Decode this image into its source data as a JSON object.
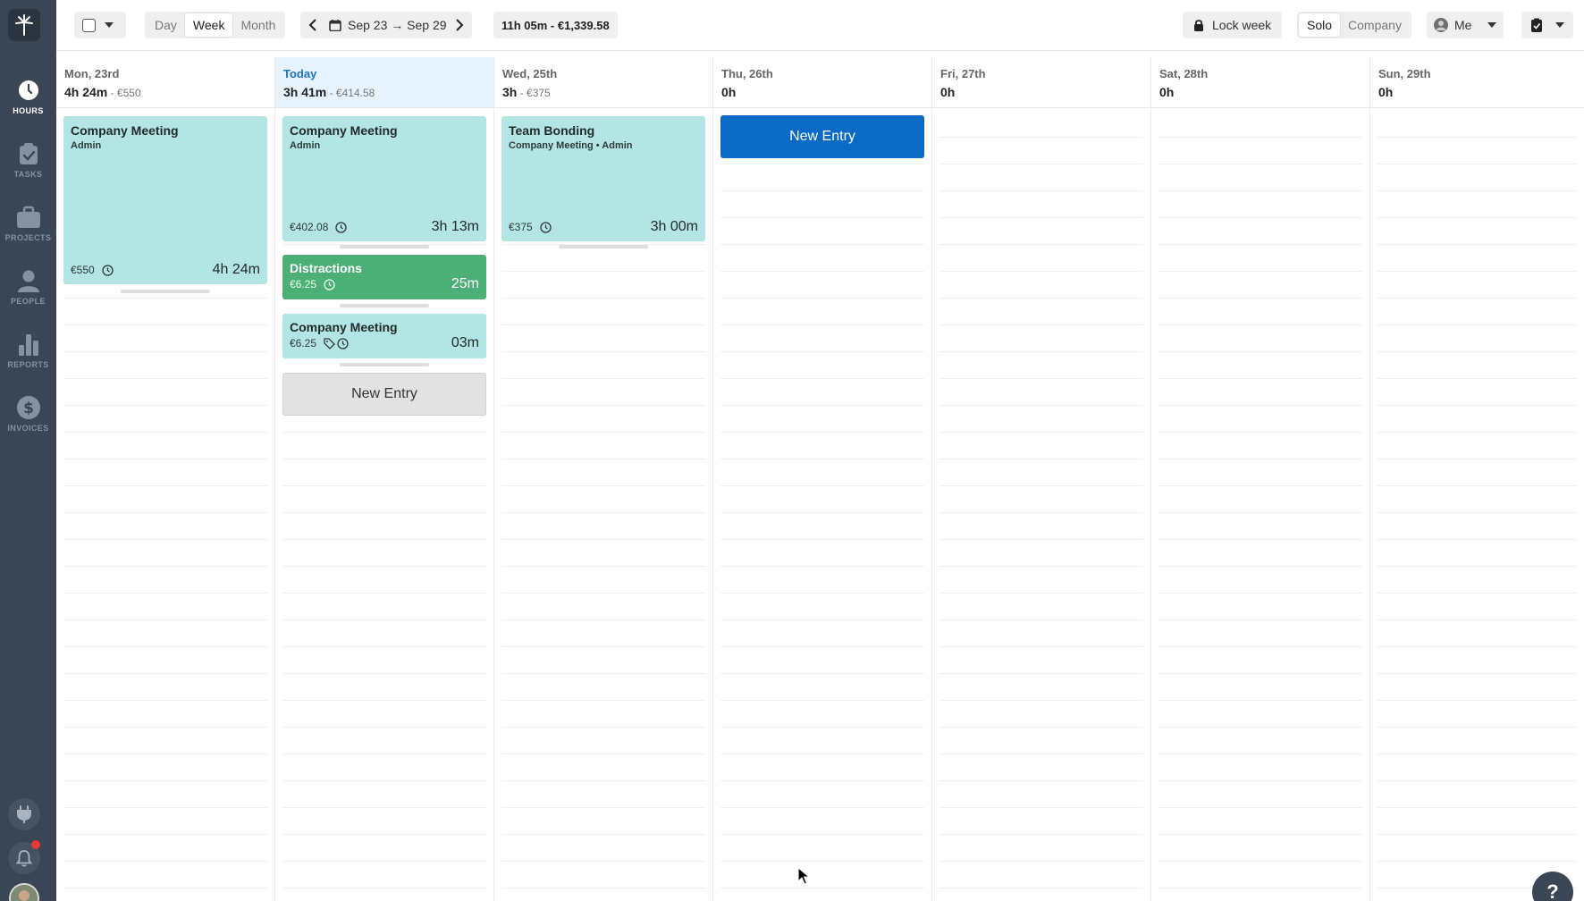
{
  "sidebar": {
    "items": [
      {
        "label": "HOURS",
        "icon": "clock-icon",
        "active": true
      },
      {
        "label": "TASKS",
        "icon": "clipboard-check-icon",
        "active": false
      },
      {
        "label": "PROJECTS",
        "icon": "briefcase-icon",
        "active": false
      },
      {
        "label": "PEOPLE",
        "icon": "person-icon",
        "active": false
      },
      {
        "label": "REPORTS",
        "icon": "bar-chart-icon",
        "active": false
      },
      {
        "label": "INVOICES",
        "icon": "dollar-icon",
        "active": false
      }
    ]
  },
  "toolbar": {
    "views": [
      "Day",
      "Week",
      "Month"
    ],
    "active_view": "Week",
    "date_range": "Sep 23 → Sep 29",
    "week_summary": "11h 05m - €1,339.58",
    "lock_week": "Lock week",
    "scope": [
      "Solo",
      "Company"
    ],
    "active_scope": "Solo",
    "user": "Me"
  },
  "days": [
    {
      "name": "Mon, 23rd",
      "total": "4h 24m",
      "money": "€550"
    },
    {
      "name": "Today",
      "total": "3h 41m",
      "money": "€414.58"
    },
    {
      "name": "Wed, 25th",
      "total": "3h",
      "money": "€375"
    },
    {
      "name": "Thu, 26th",
      "total": "0h",
      "money": ""
    },
    {
      "name": "Fri, 27th",
      "total": "0h",
      "money": ""
    },
    {
      "name": "Sat, 28th",
      "total": "0h",
      "money": ""
    },
    {
      "name": "Sun, 29th",
      "total": "0h",
      "money": ""
    }
  ],
  "entries": {
    "mon_1": {
      "title": "Company Meeting",
      "sub": "Admin",
      "amount": "€550",
      "duration": "4h 24m"
    },
    "tue_1": {
      "title": "Company Meeting",
      "sub": "Admin",
      "amount": "€402.08",
      "duration": "3h 13m"
    },
    "tue_2": {
      "title": "Distractions",
      "amount": "€6.25",
      "duration": "25m"
    },
    "tue_3": {
      "title": "Company Meeting",
      "amount": "€6.25",
      "duration": "03m"
    },
    "wed_1": {
      "title": "Team Bonding",
      "sub": "Company Meeting • Admin",
      "amount": "€375",
      "duration": "3h 00m"
    }
  },
  "new_entry_label": "New Entry",
  "help_label": "?",
  "colors": {
    "sidebar": "#3a4654",
    "entry": "#b2e5e3",
    "distraction": "#4caf76",
    "primary": "#0a6bc6",
    "today_bg": "#e6f3fc"
  }
}
